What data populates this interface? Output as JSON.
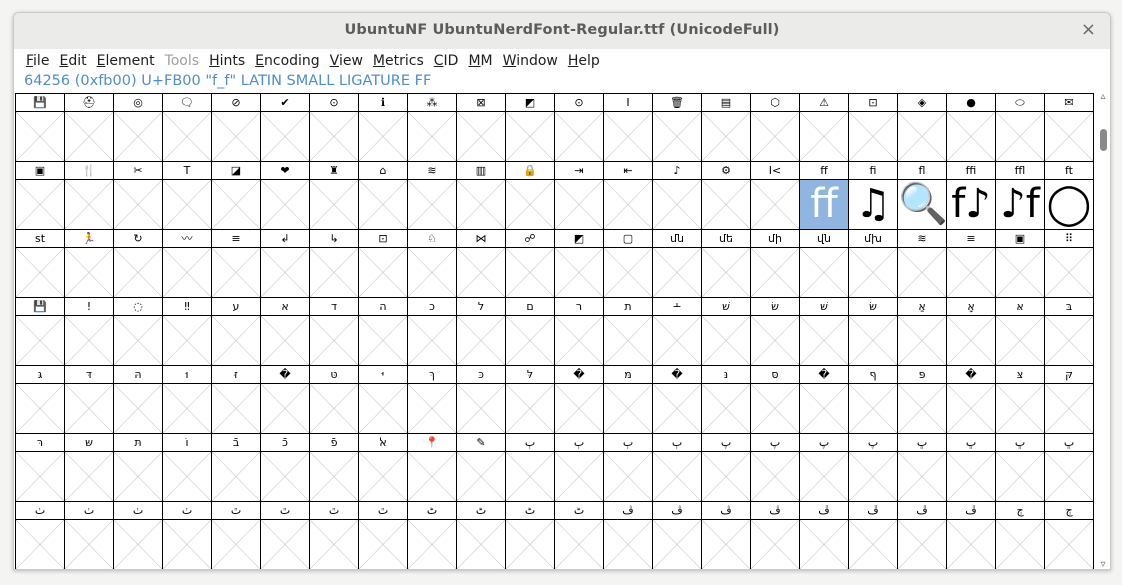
{
  "window": {
    "title": "UbuntuNF UbuntuNerdFont-Regular.ttf (UnicodeFull)",
    "close_icon": "×"
  },
  "menu": [
    {
      "label": "File",
      "disabled": false
    },
    {
      "label": "Edit",
      "disabled": false
    },
    {
      "label": "Element",
      "disabled": false
    },
    {
      "label": "Tools",
      "disabled": true
    },
    {
      "label": "Hints",
      "disabled": false
    },
    {
      "label": "Encoding",
      "disabled": false
    },
    {
      "label": "View",
      "disabled": false
    },
    {
      "label": "Metrics",
      "disabled": false
    },
    {
      "label": "CID",
      "disabled": false
    },
    {
      "label": "MM",
      "disabled": false
    },
    {
      "label": "Window",
      "disabled": false
    },
    {
      "label": "Help",
      "disabled": false
    }
  ],
  "info": {
    "text": "64256 (0xfb00) U+FB00 \"f_f\" LATIN SMALL LIGATURE FF"
  },
  "colors": {
    "selection": "#8fb6e1",
    "info_text": "#4f8ecd"
  },
  "glyph_grid": {
    "rows": [
      {
        "cells": [
          {
            "label": "💾"
          },
          {
            "label": "⛑"
          },
          {
            "label": "◎"
          },
          {
            "label": "🗨"
          },
          {
            "label": "⊘"
          },
          {
            "label": "✔"
          },
          {
            "label": "⊙"
          },
          {
            "label": "ℹ"
          },
          {
            "label": "⁂"
          },
          {
            "label": "⊠"
          },
          {
            "label": "◩"
          },
          {
            "label": "⊙"
          },
          {
            "label": "I"
          },
          {
            "label": "🗑"
          },
          {
            "label": "▤"
          },
          {
            "label": "⬡"
          },
          {
            "label": "⚠"
          },
          {
            "label": "⊡"
          },
          {
            "label": "◈"
          },
          {
            "label": "●"
          },
          {
            "label": "⬭"
          },
          {
            "label": "✉"
          }
        ]
      },
      {
        "cells": [
          {
            "label": "▣"
          },
          {
            "label": "🍴"
          },
          {
            "label": "✂"
          },
          {
            "label": "T"
          },
          {
            "label": "◪"
          },
          {
            "label": "❤"
          },
          {
            "label": "♜"
          },
          {
            "label": "⌂"
          },
          {
            "label": "≋"
          },
          {
            "label": "▥"
          },
          {
            "label": "🔒"
          },
          {
            "label": "⇥"
          },
          {
            "label": "⇤"
          },
          {
            "label": "♪"
          },
          {
            "label": "⚙"
          },
          {
            "label": "I<"
          },
          {
            "label": "ff",
            "glyph": "ff",
            "selected": true
          },
          {
            "label": "fi",
            "glyph": "♫"
          },
          {
            "label": "fl",
            "glyph": "🔍"
          },
          {
            "label": "ffi",
            "glyph": "f♪"
          },
          {
            "label": "ffl",
            "glyph": "♪f"
          },
          {
            "label": "ft",
            "glyph": "◯"
          }
        ]
      },
      {
        "cells": [
          {
            "label": "st"
          },
          {
            "label": "🏃"
          },
          {
            "label": "↻"
          },
          {
            "label": "〰"
          },
          {
            "label": "≡"
          },
          {
            "label": "↲"
          },
          {
            "label": "↳"
          },
          {
            "label": "⊡"
          },
          {
            "label": "♘"
          },
          {
            "label": "⋈"
          },
          {
            "label": "☍"
          },
          {
            "label": "◩"
          },
          {
            "label": "▢"
          },
          {
            "label": "մն"
          },
          {
            "label": "մե"
          },
          {
            "label": "մի"
          },
          {
            "label": "վն"
          },
          {
            "label": "մխ"
          },
          {
            "label": "≋"
          },
          {
            "label": "≡"
          },
          {
            "label": "▣"
          },
          {
            "label": "⠿"
          }
        ]
      },
      {
        "cells": [
          {
            "label": "💾"
          },
          {
            "label": "!"
          },
          {
            "label": "◌"
          },
          {
            "label": "‼"
          },
          {
            "label": "ע"
          },
          {
            "label": "א"
          },
          {
            "label": "ד"
          },
          {
            "label": "ה"
          },
          {
            "label": "כ"
          },
          {
            "label": "ל"
          },
          {
            "label": "ם"
          },
          {
            "label": "ר"
          },
          {
            "label": "ת"
          },
          {
            "label": "﬩"
          },
          {
            "label": "שׁ"
          },
          {
            "label": "שׂ"
          },
          {
            "label": "שּׁ"
          },
          {
            "label": "שּׂ"
          },
          {
            "label": "אַ"
          },
          {
            "label": "אָ"
          },
          {
            "label": "אּ"
          },
          {
            "label": "בּ"
          }
        ]
      },
      {
        "cells": [
          {
            "label": "גּ"
          },
          {
            "label": "דּ"
          },
          {
            "label": "הּ"
          },
          {
            "label": "וּ"
          },
          {
            "label": "זּ"
          },
          {
            "label": "�"
          },
          {
            "label": "טּ"
          },
          {
            "label": "יּ"
          },
          {
            "label": "ךּ"
          },
          {
            "label": "כּ"
          },
          {
            "label": "לּ"
          },
          {
            "label": "�"
          },
          {
            "label": "מּ"
          },
          {
            "label": "�"
          },
          {
            "label": "נּ"
          },
          {
            "label": "סּ"
          },
          {
            "label": "�"
          },
          {
            "label": "ףּ"
          },
          {
            "label": "פּ"
          },
          {
            "label": "�"
          },
          {
            "label": "צּ"
          },
          {
            "label": "קּ"
          }
        ]
      },
      {
        "cells": [
          {
            "label": "רּ"
          },
          {
            "label": "שּ"
          },
          {
            "label": "תּ"
          },
          {
            "label": "וֹ"
          },
          {
            "label": "בֿ"
          },
          {
            "label": "כֿ"
          },
          {
            "label": "פֿ"
          },
          {
            "label": "ﭏ"
          },
          {
            "label": "📍"
          },
          {
            "label": "✎"
          },
          {
            "label": "ٻ"
          },
          {
            "label": "ٻ"
          },
          {
            "label": "ٻ"
          },
          {
            "label": "ٻ"
          },
          {
            "label": "پ"
          },
          {
            "label": "پ"
          },
          {
            "label": "پ"
          },
          {
            "label": "پ"
          },
          {
            "label": "ڀ"
          },
          {
            "label": "ڀ"
          },
          {
            "label": "ڀ"
          },
          {
            "label": "ڀ"
          }
        ]
      },
      {
        "cells": [
          {
            "label": "ٺ"
          },
          {
            "label": "ٺ"
          },
          {
            "label": "ٺ"
          },
          {
            "label": "ٺ"
          },
          {
            "label": "ٿ"
          },
          {
            "label": "ٿ"
          },
          {
            "label": "ٿ"
          },
          {
            "label": "ٿ"
          },
          {
            "label": "ٹ"
          },
          {
            "label": "ٹ"
          },
          {
            "label": "ٹ"
          },
          {
            "label": "ٹ"
          },
          {
            "label": "ڤ"
          },
          {
            "label": "ڤ"
          },
          {
            "label": "ڤ"
          },
          {
            "label": "ڤ"
          },
          {
            "label": "ڦ"
          },
          {
            "label": "ڦ"
          },
          {
            "label": "ڦ"
          },
          {
            "label": "ڦ"
          },
          {
            "label": "ڄ"
          },
          {
            "label": "ڄ"
          }
        ]
      }
    ]
  }
}
